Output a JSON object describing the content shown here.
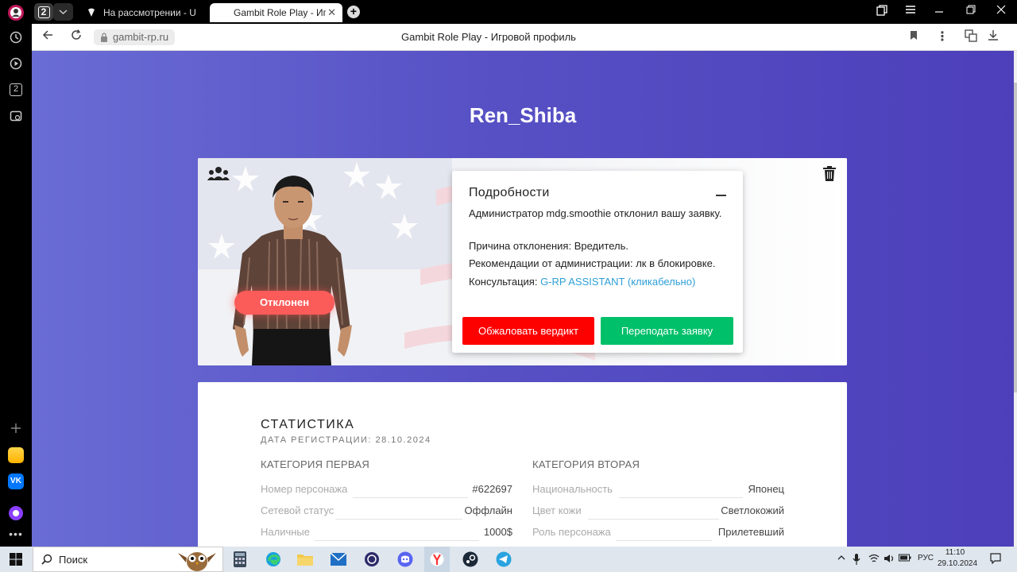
{
  "browser": {
    "tab_count": "2",
    "tabs": [
      {
        "label": "На рассмотрении - UCP r"
      },
      {
        "label": "Gambit Role Play - Игрово"
      }
    ],
    "url": "gambit-rp.ru",
    "page_title": "Gambit Role Play - Игровой профиль",
    "sidebar_counter": "2"
  },
  "profile": {
    "nickname": "Ren_Shiba",
    "status": "Отклонен",
    "details": {
      "title": "Подробности",
      "line1": "Администратор mdg.smoothie отклонил вашу заявку.",
      "line2": "Причина отклонения: Вредитель.",
      "line3": "Рекомендации от администрации: лк в блокировке.",
      "line4_prefix": "Консультация: ",
      "line4_link": "G-RP ASSISTANT (кликабельно)",
      "appeal_button": "Обжаловать вердикт",
      "resubmit_button": "Переподать заявку"
    }
  },
  "stats": {
    "title": "СТАТИСТИКА",
    "reg_date": "ДАТА РЕГИСТРАЦИИ: 28.10.2024",
    "category1": {
      "name": "КАТЕГОРИЯ ПЕРВАЯ",
      "rows": [
        {
          "label": "Номер персонажа",
          "value": "#622697"
        },
        {
          "label": "Сетевой статус",
          "value": "Оффлайн"
        },
        {
          "label": "Наличные",
          "value": "1000$"
        }
      ]
    },
    "category2": {
      "name": "КАТЕГОРИЯ ВТОРАЯ",
      "rows": [
        {
          "label": "Национальность",
          "value": "Японец"
        },
        {
          "label": "Цвет кожи",
          "value": "Светлокожий"
        },
        {
          "label": "Роль персонажа",
          "value": "Прилетевший"
        }
      ]
    }
  },
  "taskbar": {
    "search_label": "Поиск",
    "language": "РУС",
    "time": "11:10",
    "date": "29.10.2024"
  },
  "colors": {
    "accent_red": "#fd0000",
    "accent_green": "#00c06a",
    "status_pill": "#fb5b59",
    "link": "#2e9fd6",
    "page_gradient_start": "#6a6cd5",
    "page_gradient_end": "#4d3fba"
  }
}
